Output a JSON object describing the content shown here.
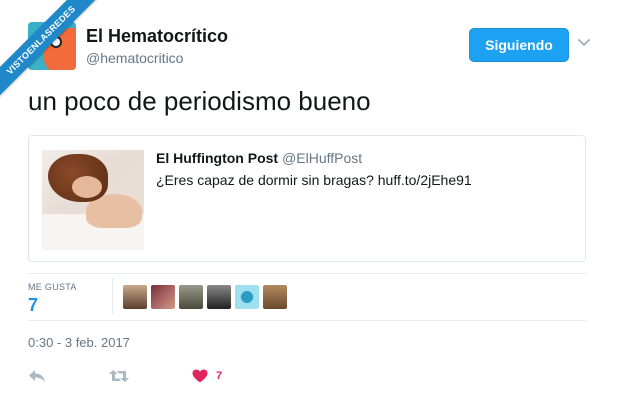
{
  "watermark": {
    "text": "VISTOENLASREDES"
  },
  "author": {
    "display_name": "El Hematocrítico",
    "handle": "@hematocritico",
    "avatar_icon": "cartoon-avatar-icon"
  },
  "follow_button": {
    "label": "Siguiendo",
    "color": "#1da1f2"
  },
  "tweet": {
    "text": "un poco de periodismo bueno"
  },
  "quoted_tweet": {
    "author_name": "El Huffington Post",
    "author_handle": "@ElHuffPost",
    "text": "¿Eres capaz de dormir sin bragas? huff.to/2jEhe91"
  },
  "stats": {
    "likes_label": "ME GUSTA",
    "likes_count": "7",
    "likers_count": 6
  },
  "timestamp": "0:30 - 3 feb. 2017",
  "actions": {
    "reply_icon": "reply-icon",
    "retweet_icon": "retweet-icon",
    "like_icon": "heart-icon",
    "like_count": "7"
  },
  "colors": {
    "link_blue": "#1b95e0",
    "like_red": "#e0245e",
    "muted": "#657786",
    "ribbon": "#1e88c8"
  }
}
